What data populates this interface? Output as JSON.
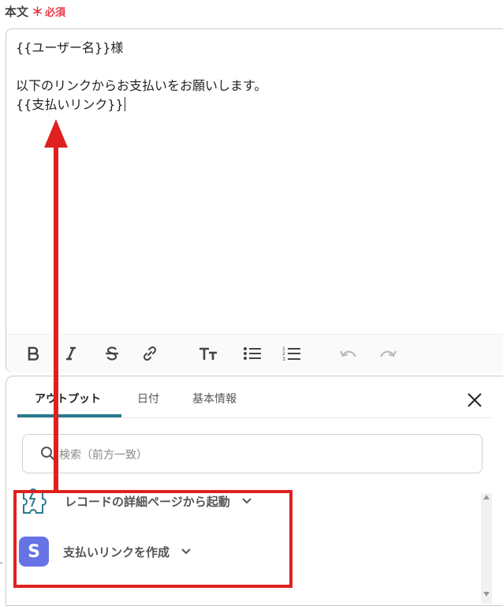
{
  "field": {
    "label": "本文",
    "required_star": "＊",
    "required_text": "必須"
  },
  "editor": {
    "lines": [
      "{{ユーザー名}}様",
      "",
      "以下のリンクからお支払いをお願いします。",
      "{{支払いリンク}}"
    ]
  },
  "toolbar": {
    "icons": [
      "bold-icon",
      "italic-icon",
      "strikethrough-icon",
      "link-icon",
      "text-size-icon",
      "bullet-list-icon",
      "numbered-list-icon",
      "undo-icon",
      "redo-icon"
    ]
  },
  "panel": {
    "tabs": [
      {
        "label": "アウトプット",
        "active": true
      },
      {
        "label": "日付",
        "active": false
      },
      {
        "label": "基本情報",
        "active": false
      }
    ],
    "search_placeholder": "検索（前方一致）",
    "items": [
      {
        "label": "レコードの詳細ページから起動",
        "icon": "puzzle-icon"
      },
      {
        "label": "支払いリンクを作成",
        "icon": "stripe-s-icon",
        "badge_letter": "S"
      }
    ]
  },
  "colors": {
    "accent": "#2b7a8f",
    "annotation": "#e02020",
    "required": "#e63946",
    "stripe": "#6772e5"
  }
}
